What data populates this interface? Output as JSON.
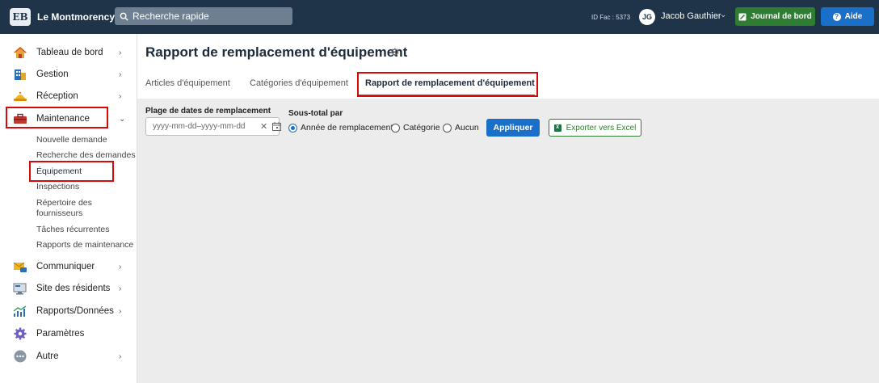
{
  "topbar": {
    "logo_text": "EB",
    "app_title": "Le Montmorency",
    "search_placeholder": "Recherche rapide",
    "fac_id": "ID Fac : 5373",
    "user_initials": "JG",
    "user_name": "Jacob Gauthier",
    "journal_label": "Journal de bord",
    "aide_label": "Aide"
  },
  "sidebar": {
    "items": [
      {
        "label": "Tableau de bord",
        "icon": "house-icon"
      },
      {
        "label": "Gestion",
        "icon": "building-icon"
      },
      {
        "label": "Réception",
        "icon": "bell-icon"
      },
      {
        "label": "Maintenance",
        "icon": "toolbox-icon"
      },
      {
        "label": "Communiquer",
        "icon": "mail-icon"
      },
      {
        "label": "Site des résidents",
        "icon": "monitor-icon"
      },
      {
        "label": "Rapports/Données",
        "icon": "chart-icon"
      },
      {
        "label": "Paramètres",
        "icon": "gear-icon"
      },
      {
        "label": "Autre",
        "icon": "more-icon"
      }
    ],
    "maintenance_sub": [
      "Nouvelle demande",
      "Recherche des demandes",
      "Équipement",
      "Inspections",
      "Répertoire des fournisseurs",
      "Tâches récurrentes",
      "Rapports de maintenance"
    ]
  },
  "main": {
    "title": "Rapport de remplacement d'équipement",
    "tabs": [
      {
        "label": "Articles d'équipement"
      },
      {
        "label": "Catégories d'équipement"
      },
      {
        "label": "Rapport de remplacement d'équipement"
      }
    ],
    "filters": {
      "date_range_label": "Plage de dates de remplacement",
      "date_placeholder": "yyyy-mm-dd–yyyy-mm-dd",
      "subtotal_label": "Sous-total par",
      "radio_options": [
        "Année de remplacement",
        "Catégorie",
        "Aucun"
      ],
      "selected": "Année de remplacement",
      "apply_label": "Appliquer",
      "export_label": "Exporter vers Excel"
    }
  },
  "colors": {
    "topbar": "#1f3349",
    "accent": "#1a6fc9",
    "green": "#2e7d32",
    "highlight": "#d40b0b"
  }
}
